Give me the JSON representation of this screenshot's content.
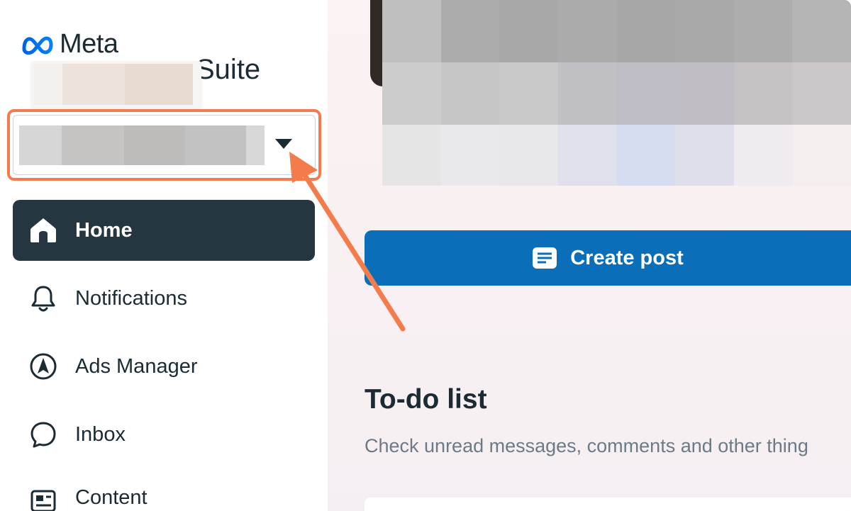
{
  "brand": {
    "logo_text": "Meta",
    "suffix": "Suite"
  },
  "nav": {
    "home": "Home",
    "notifications": "Notifications",
    "ads_manager": "Ads Manager",
    "inbox": "Inbox",
    "content": "Content"
  },
  "main": {
    "create_post_label": "Create post",
    "todo_title": "To-do list",
    "todo_description": "Check unread messages, comments and other thing"
  },
  "colors": {
    "accent": "#0a6fb8",
    "sidebar_active": "#253640",
    "annotation": "#f47c4c"
  },
  "icons": {
    "home": "home-icon",
    "notifications": "bell-icon",
    "ads_manager": "compass-icon",
    "inbox": "chat-bubble-icon",
    "content": "content-icon",
    "create_post": "post-icon",
    "selector": "caret-down-icon"
  }
}
